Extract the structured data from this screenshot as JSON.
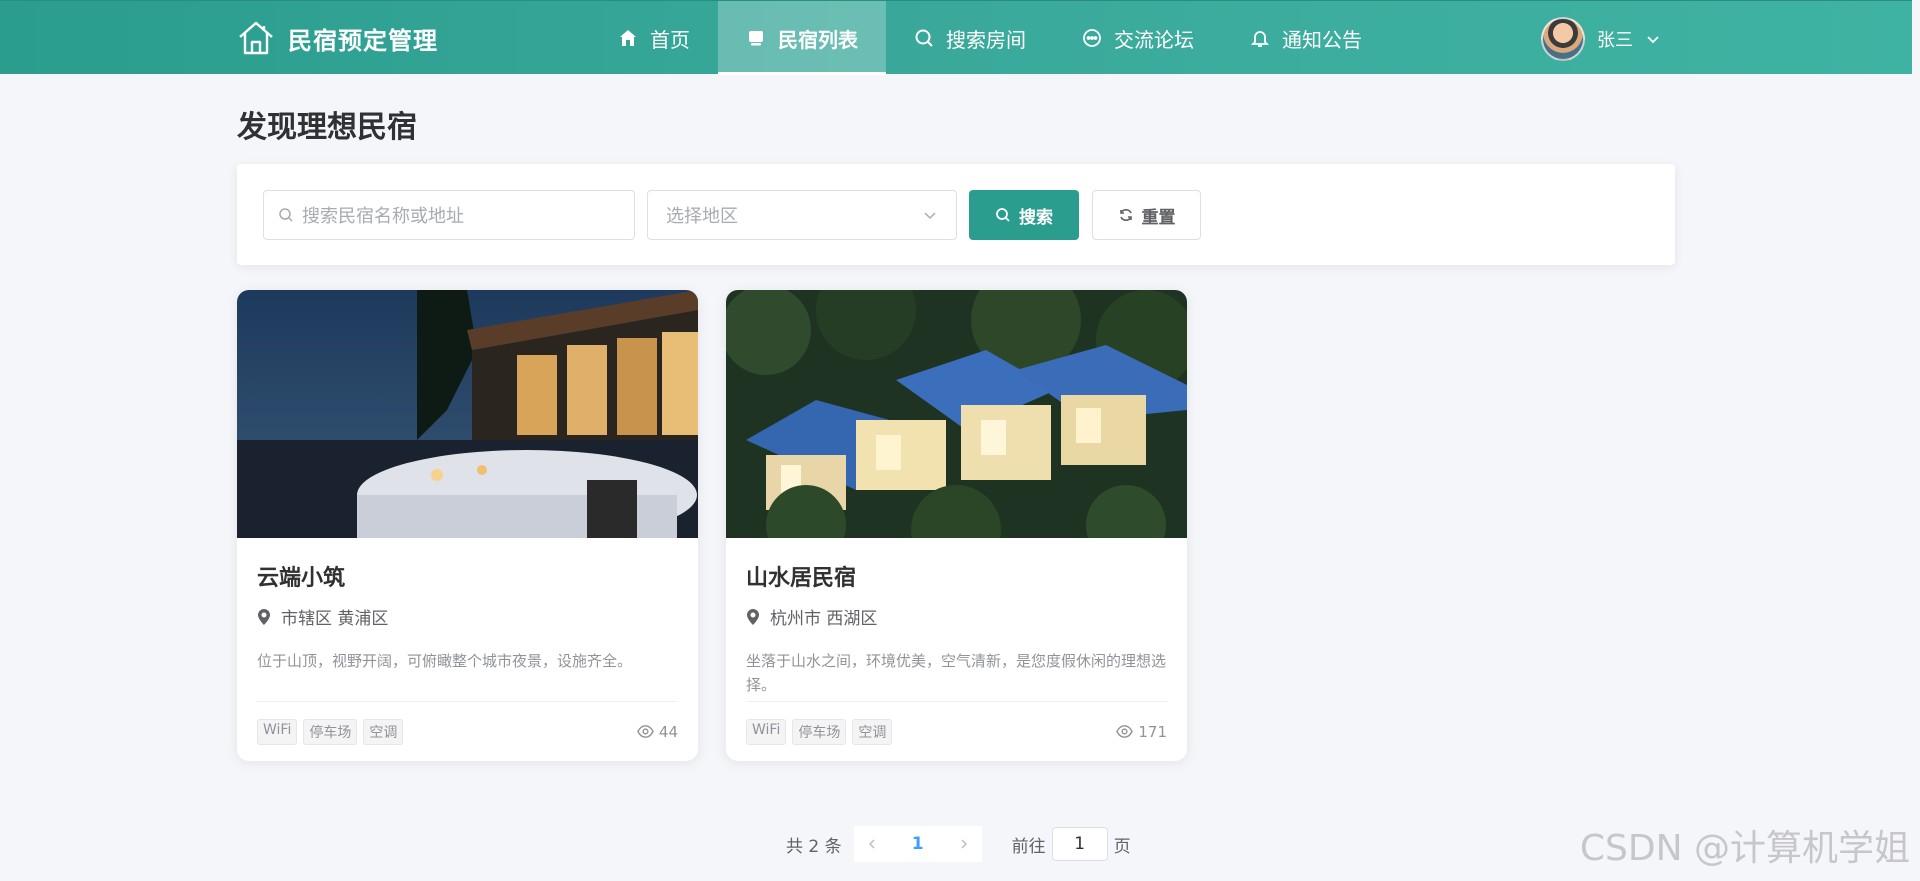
{
  "header": {
    "brand": "民宿预定管理",
    "nav": [
      {
        "label": "首页",
        "icon": "home-icon"
      },
      {
        "label": "民宿列表",
        "icon": "list-icon",
        "active": true
      },
      {
        "label": "搜索房间",
        "icon": "search-icon"
      },
      {
        "label": "交流论坛",
        "icon": "chat-icon"
      },
      {
        "label": "通知公告",
        "icon": "bell-icon"
      }
    ],
    "user": {
      "name": "张三"
    }
  },
  "page": {
    "title": "发现理想民宿"
  },
  "search": {
    "placeholder": "搜索民宿名称或地址",
    "region_placeholder": "选择地区",
    "search_label": "搜索",
    "reset_label": "重置"
  },
  "cards": [
    {
      "name": "云端小筑",
      "location": "市辖区 黄浦区",
      "description": "位于山顶，视野开阔，可俯瞰整个城市夜景，设施齐全。",
      "tags": [
        "WiFi",
        "停车场",
        "空调"
      ],
      "views": "44"
    },
    {
      "name": "山水居民宿",
      "location": "杭州市 西湖区",
      "description": "坐落于山水之间，环境优美，空气清新，是您度假休闲的理想选择。",
      "tags": [
        "WiFi",
        "停车场",
        "空调"
      ],
      "views": "171"
    }
  ],
  "pagination": {
    "total": "共 2 条",
    "current": "1",
    "goto_prefix": "前往",
    "goto_value": "1",
    "goto_suffix": "页"
  },
  "watermark": "CSDN @计算机学姐",
  "colors": {
    "primary": "#2a9d8f",
    "page_bg": "#f5f6fa",
    "link": "#409eff"
  }
}
